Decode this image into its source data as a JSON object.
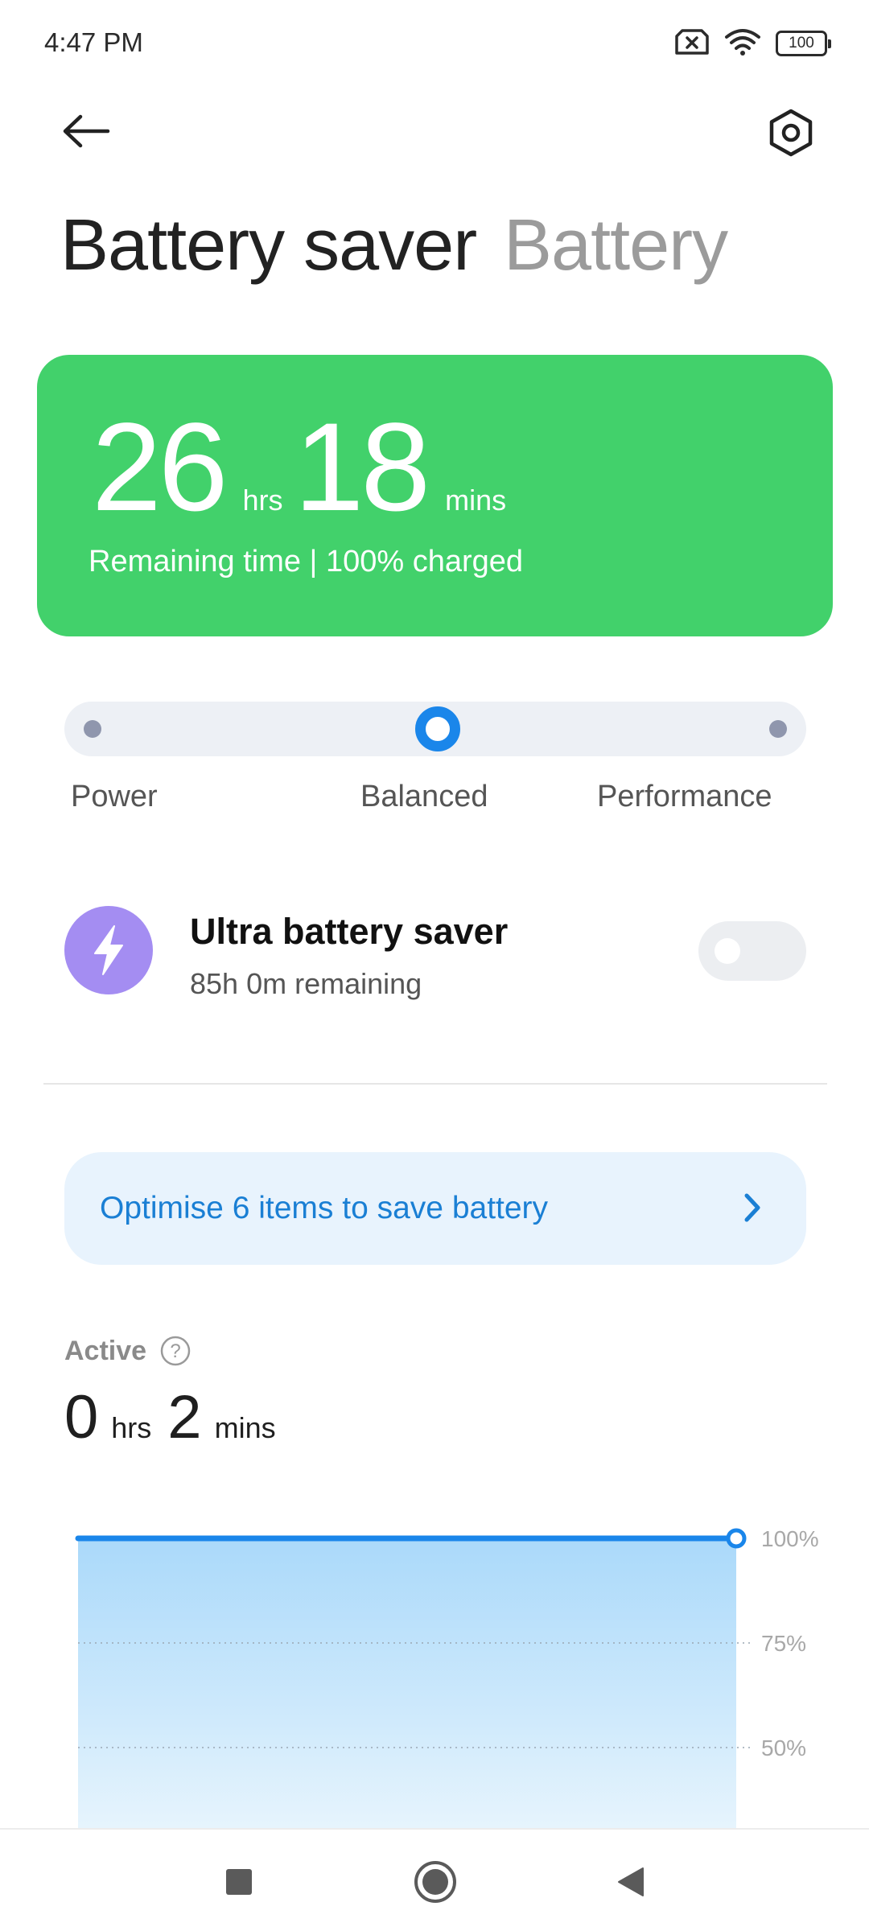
{
  "status_bar": {
    "time": "4:47 PM",
    "battery_level": "100",
    "icons": [
      "no-sim-icon",
      "wifi-icon",
      "battery-icon"
    ]
  },
  "header": {
    "back_icon": "back-arrow-icon",
    "settings_icon": "settings-hexagon-icon",
    "tab_active": "Battery saver",
    "tab_inactive": "Battery"
  },
  "remaining_card": {
    "hours": "26",
    "hours_unit": "hrs",
    "minutes": "18",
    "minutes_unit": "mins",
    "subtitle": "Remaining time | 100% charged",
    "color": "#42d16b"
  },
  "mode_slider": {
    "options": [
      "Power",
      "Balanced",
      "Performance"
    ],
    "selected": "Balanced",
    "accent": "#1a86ea"
  },
  "ultra_saver": {
    "icon": "lightning-bolt-icon",
    "title": "Ultra battery saver",
    "subtitle": "85h 0m remaining",
    "enabled": false
  },
  "optimise_banner": {
    "text": "Optimise 6 items to save battery",
    "icon": "chevron-right-icon"
  },
  "active": {
    "label": "Active",
    "help_icon": "question-circle-icon",
    "hours": "0",
    "hours_unit": "hrs",
    "minutes": "2",
    "minutes_unit": "mins"
  },
  "chart_data": {
    "type": "area",
    "y_tick_labels": [
      "100%",
      "75%",
      "50%"
    ],
    "values": [
      100,
      100
    ],
    "ylim": [
      0,
      100
    ],
    "grid": true,
    "color": "#1a86ea"
  },
  "nav_bar": {
    "icons": [
      "recents-square-icon",
      "home-circle-icon",
      "back-triangle-icon"
    ]
  }
}
